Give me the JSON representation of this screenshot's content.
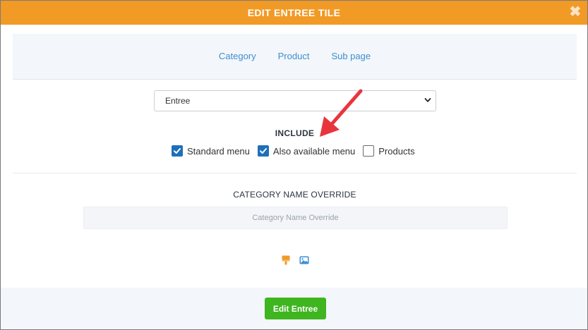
{
  "modal": {
    "title": "EDIT ENTREE TILE",
    "close_glyph": "✖"
  },
  "tabs": [
    {
      "label": "Category"
    },
    {
      "label": "Product"
    },
    {
      "label": "Sub page"
    }
  ],
  "category_select": {
    "selected": "Entree"
  },
  "include": {
    "title": "INCLUDE",
    "options": [
      {
        "label": "Standard menu",
        "checked": true
      },
      {
        "label": "Also available menu",
        "checked": true
      },
      {
        "label": "Products",
        "checked": false
      }
    ]
  },
  "override": {
    "title": "CATEGORY NAME OVERRIDE",
    "placeholder": "Category Name Override",
    "value": ""
  },
  "tools": {
    "paint_icon": "paint-brush-icon",
    "image_icon": "image-icon"
  },
  "footer": {
    "primary_label": "Edit Entree"
  },
  "colors": {
    "header": "#f19a26",
    "link": "#3d8fd1",
    "checkbox": "#1f6fb8",
    "primary": "#3fb51f",
    "annotation_arrow": "#e8353d"
  }
}
